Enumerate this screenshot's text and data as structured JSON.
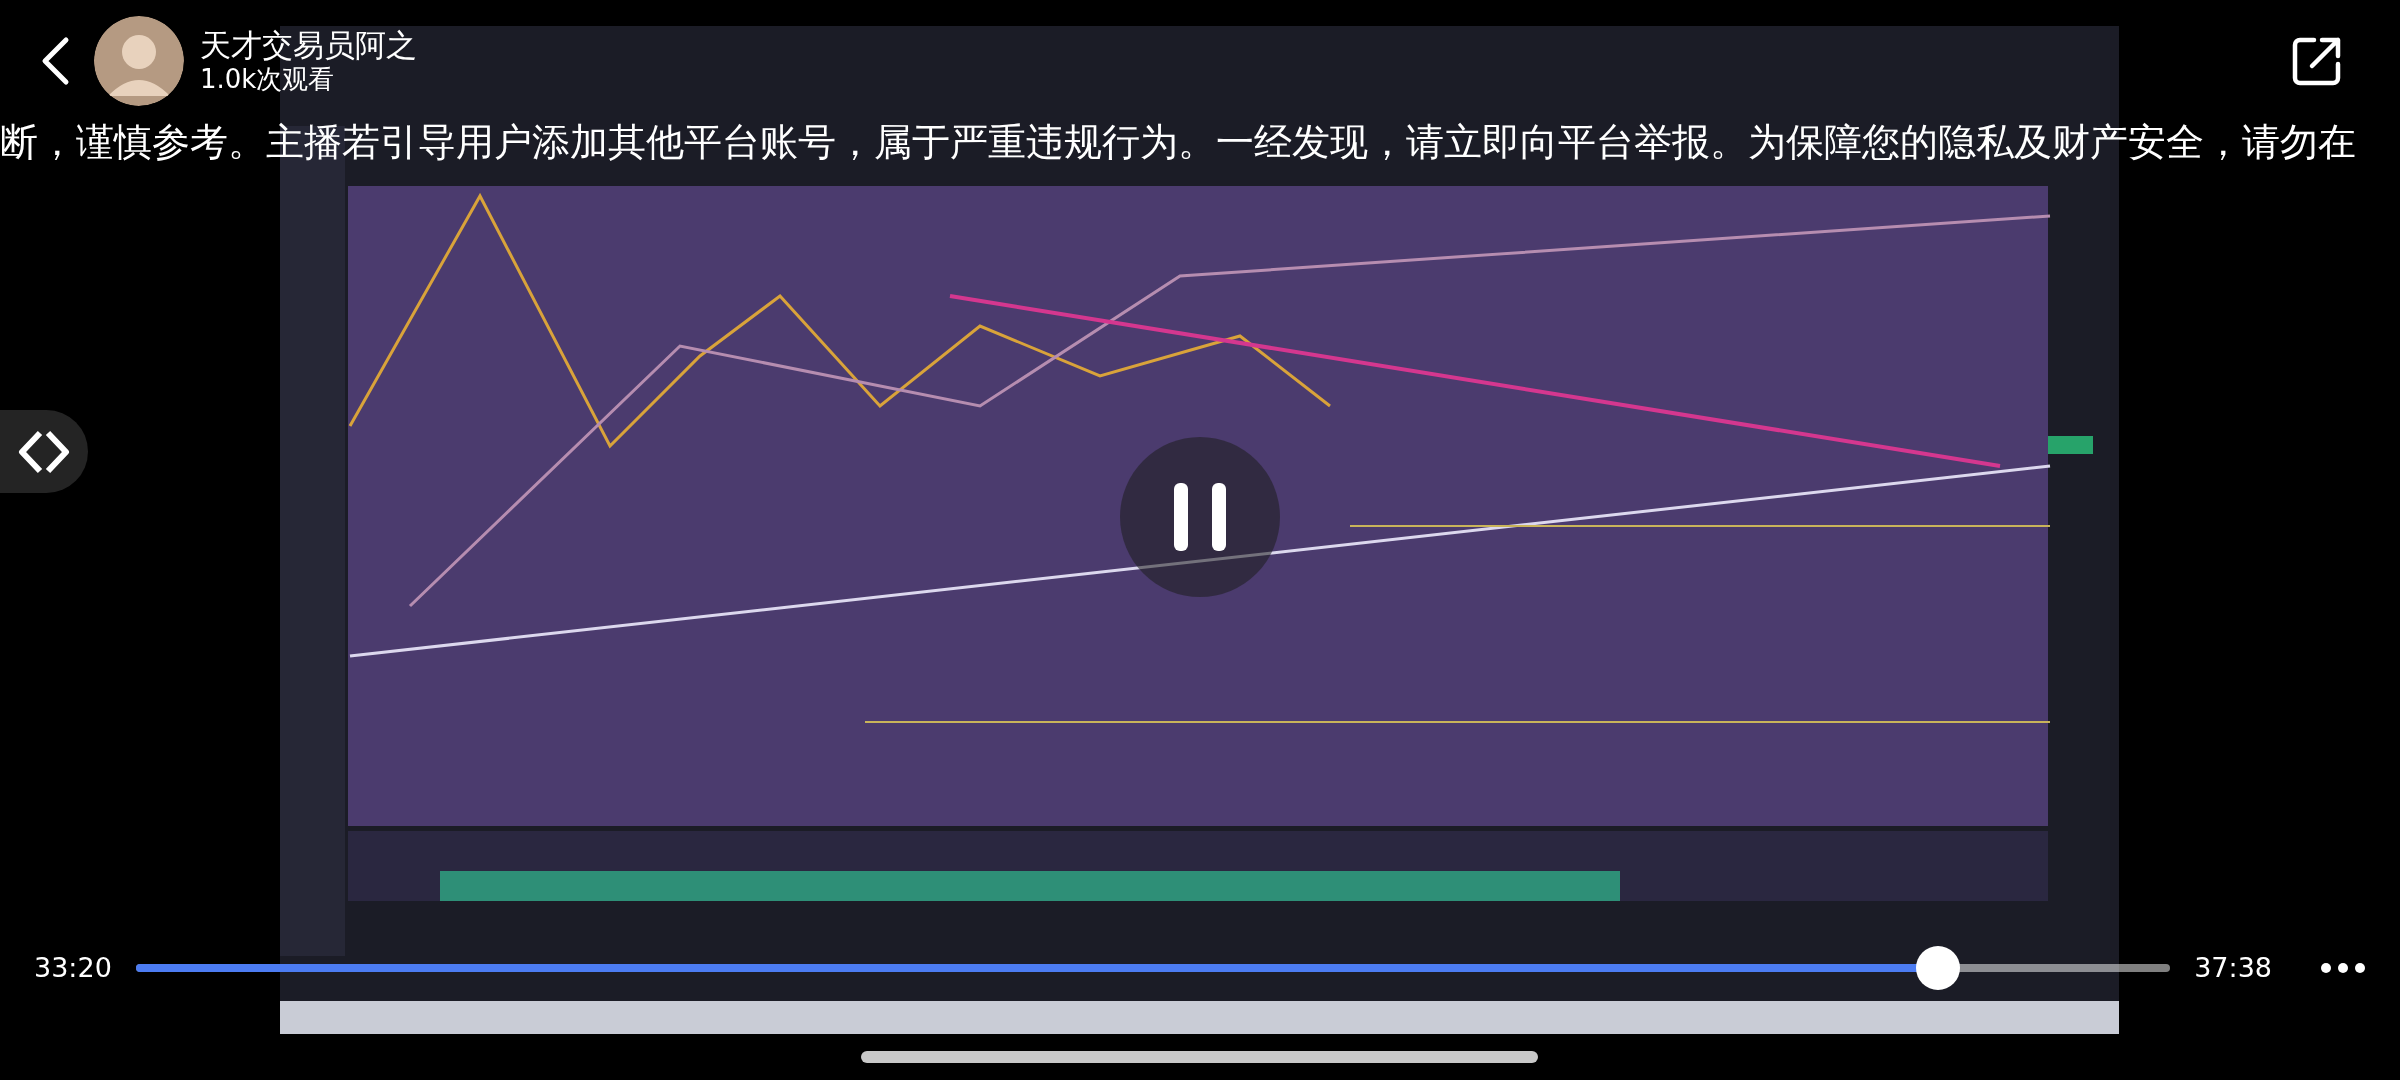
{
  "header": {
    "title": "天才交易员阿之",
    "views": "1.0k次观看"
  },
  "banner": {
    "text": "断，谨慎参考。主播若引导用户添加其他平台账号，属于严重违规行为。一经发现，请立即向平台举报。为保障您的隐私及财产安全，请勿在"
  },
  "progress": {
    "elapsed": "33:20",
    "duration": "37:38",
    "level": 0.886
  }
}
